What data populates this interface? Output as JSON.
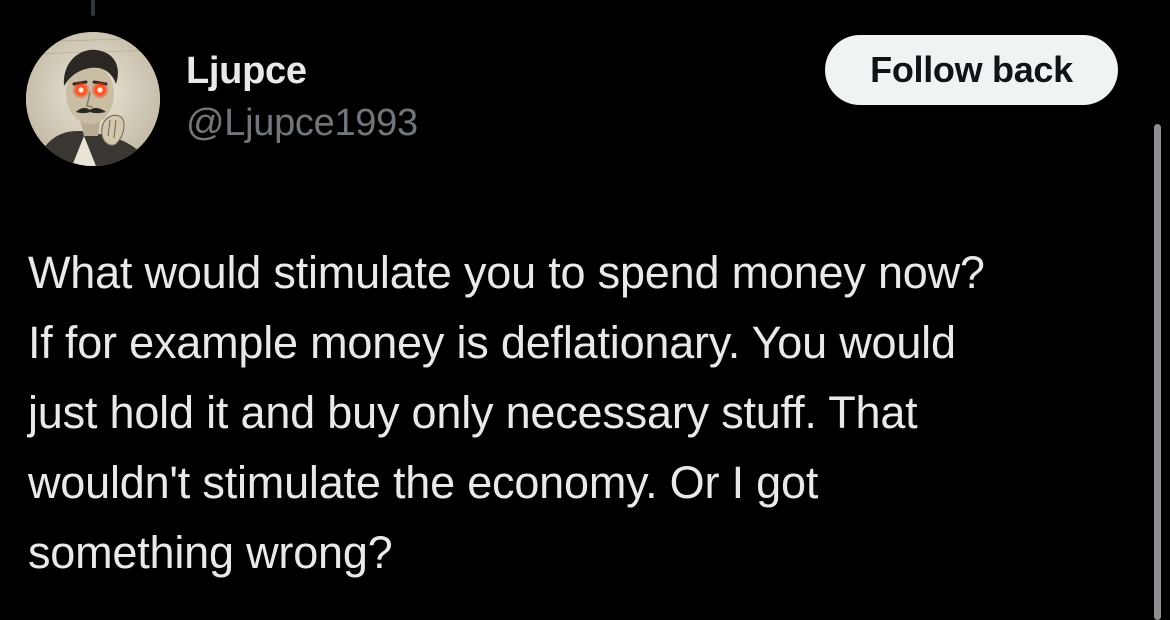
{
  "user": {
    "display_name": "Ljupce",
    "handle": "@Ljupce1993",
    "avatar_icon": "portrait-avatar-icon"
  },
  "follow_button": {
    "label": "Follow back"
  },
  "tweet": {
    "text": "What would stimulate you to spend money now?\nIf for example money is deflationary. You would\njust hold it and buy only necessary stuff. That\nwouldn't stimulate the economy. Or I got\nsomething wrong?"
  },
  "colors": {
    "background": "#000000",
    "primary_text": "#e7e9ea",
    "secondary_text": "#71767b",
    "button_bg": "#eff3f4",
    "button_text": "#0f1419"
  }
}
